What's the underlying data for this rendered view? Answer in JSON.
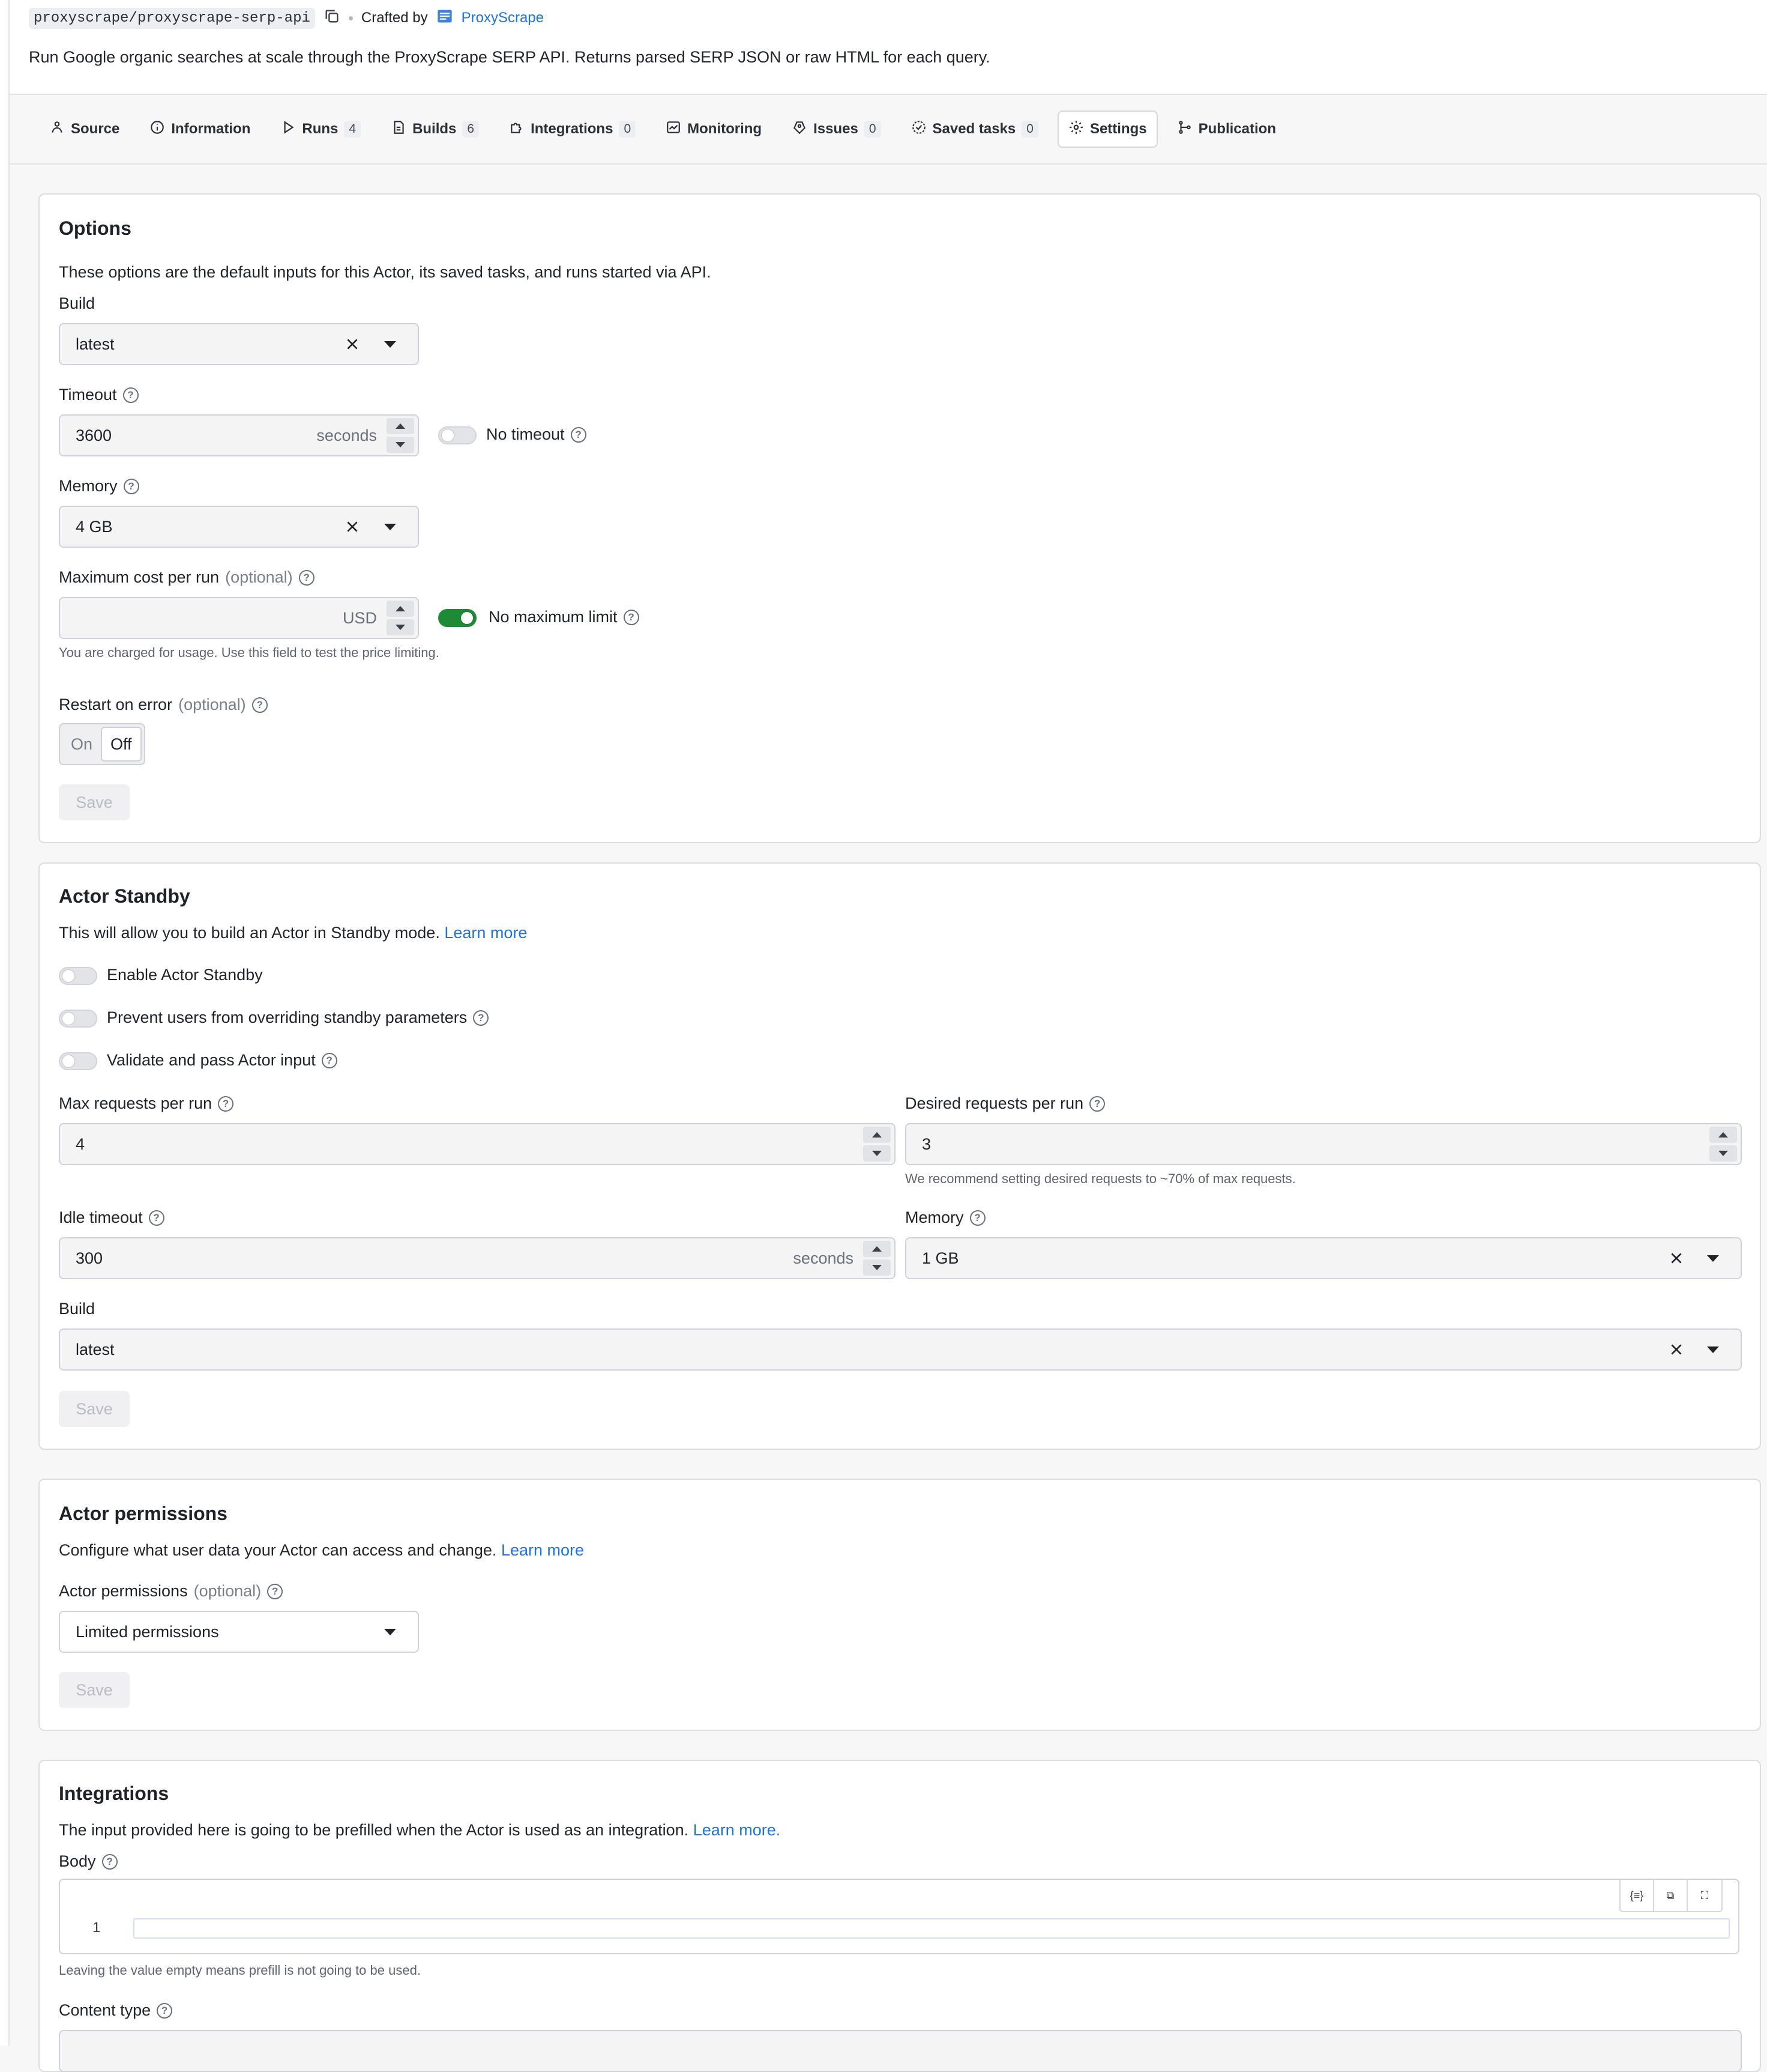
{
  "header": {
    "slug": "proxyscrape/proxyscrape-serp-api",
    "crafted_by_label": "Crafted by",
    "author": "ProxyScrape",
    "description": "Run Google organic searches at scale through the ProxyScrape SERP API. Returns parsed SERP JSON or raw HTML for each query."
  },
  "tabs": [
    {
      "label": "Source",
      "icon": "source-icon"
    },
    {
      "label": "Information",
      "icon": "info-icon"
    },
    {
      "label": "Runs",
      "count": "4",
      "icon": "play-icon"
    },
    {
      "label": "Builds",
      "count": "6",
      "icon": "builds-icon"
    },
    {
      "label": "Integrations",
      "count": "0",
      "icon": "puzzle-icon"
    },
    {
      "label": "Monitoring",
      "icon": "chart-icon"
    },
    {
      "label": "Issues",
      "count": "0",
      "icon": "bug-icon"
    },
    {
      "label": "Saved tasks",
      "count": "0",
      "icon": "task-icon"
    },
    {
      "label": "Settings",
      "icon": "gear-icon",
      "active": true
    },
    {
      "label": "Publication",
      "icon": "publish-icon"
    }
  ],
  "options": {
    "title": "Options",
    "intro": "These options are the default inputs for this Actor, its saved tasks, and runs started via API.",
    "build_label": "Build",
    "build_value": "latest",
    "timeout_label": "Timeout",
    "timeout_value": "3600",
    "timeout_unit": "seconds",
    "no_timeout_label": "No timeout",
    "no_timeout_on": false,
    "memory_label": "Memory",
    "memory_value": "4 GB",
    "max_cost_label": "Maximum cost per run",
    "optional": "(optional)",
    "max_cost_value": "",
    "max_cost_unit": "USD",
    "no_max_limit_label": "No maximum limit",
    "no_max_limit_on": true,
    "max_cost_hint": "You are charged for usage. Use this field to test the price limiting.",
    "restart_label": "Restart on error",
    "restart_on": "On",
    "restart_off": "Off",
    "restart_selected": "Off",
    "save": "Save"
  },
  "standby": {
    "title": "Actor Standby",
    "intro": "This will allow you to build an Actor in Standby mode.",
    "learn_more": "Learn more",
    "enable_label": "Enable Actor Standby",
    "prevent_label": "Prevent users from overriding standby parameters",
    "validate_label": "Validate and pass Actor input",
    "max_req_label": "Max requests per run",
    "max_req_value": "4",
    "desired_req_label": "Desired requests per run",
    "desired_req_value": "3",
    "desired_hint": "We recommend setting desired requests to ~70% of max requests.",
    "idle_label": "Idle timeout",
    "idle_value": "300",
    "idle_unit": "seconds",
    "memory_label": "Memory",
    "memory_value": "1 GB",
    "build_label": "Build",
    "build_value": "latest",
    "save": "Save"
  },
  "permissions": {
    "title": "Actor permissions",
    "intro": "Configure what user data your Actor can access and change.",
    "learn_more": "Learn more",
    "field_label": "Actor permissions",
    "optional": "(optional)",
    "value": "Limited permissions",
    "save": "Save"
  },
  "integrations": {
    "title": "Integrations",
    "intro": "The input provided here is going to be prefilled when the Actor is used as an integration.",
    "learn_more": "Learn more.",
    "body_label": "Body",
    "line_number": "1",
    "editor_buttons": [
      "{≡}",
      "⧉",
      "⛶"
    ],
    "body_hint": "Leaving the value empty means prefill is not going to be used.",
    "content_type_label": "Content type"
  },
  "colors": {
    "accent": "#1f74d6",
    "toggle_on": "#1f8a36"
  }
}
